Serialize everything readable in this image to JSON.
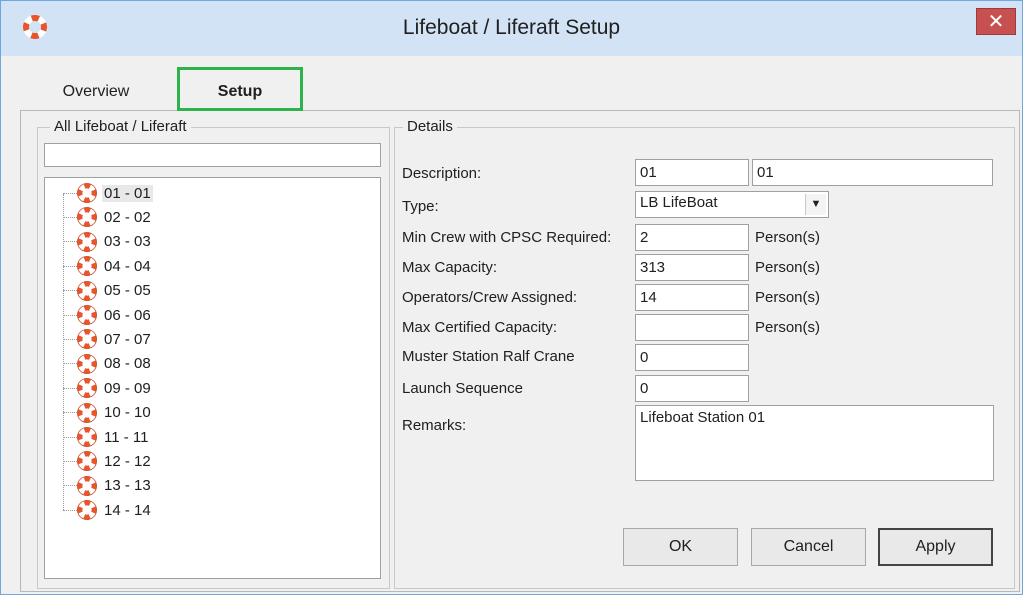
{
  "window": {
    "title": "Lifeboat / Liferaft Setup",
    "close_label": "✕"
  },
  "tabs": [
    {
      "label": "Overview"
    },
    {
      "label": "Setup"
    }
  ],
  "left_panel": {
    "legend": "All Lifeboat / Liferaft",
    "filter_value": "",
    "items": [
      {
        "label": "01 - 01"
      },
      {
        "label": "02 - 02"
      },
      {
        "label": "03 - 03"
      },
      {
        "label": "04 - 04"
      },
      {
        "label": "05 - 05"
      },
      {
        "label": "06 - 06"
      },
      {
        "label": "07 - 07"
      },
      {
        "label": "08 - 08"
      },
      {
        "label": "09 - 09"
      },
      {
        "label": "10 - 10"
      },
      {
        "label": "11 - 11"
      },
      {
        "label": "12 - 12"
      },
      {
        "label": "13 - 13"
      },
      {
        "label": "14 - 14"
      }
    ]
  },
  "details": {
    "legend": "Details",
    "description_label": "Description:",
    "description_code": "01",
    "description_name": "01",
    "type_label": "Type:",
    "type_value": "LB LifeBoat",
    "min_crew_label": "Min Crew with CPSC Required:",
    "min_crew_value": "2",
    "max_capacity_label": "Max Capacity:",
    "max_capacity_value": "313",
    "operators_label": "Operators/Crew Assigned:",
    "operators_value": "14",
    "max_certified_label": "Max Certified Capacity:",
    "max_certified_value": "",
    "muster_label": "Muster Station Ralf Crane",
    "muster_value": "0",
    "launch_label": "Launch Sequence",
    "launch_value": "0",
    "remarks_label": "Remarks:",
    "remarks_value": "Lifeboat Station 01",
    "unit_label": "Person(s)"
  },
  "buttons": {
    "ok": "OK",
    "cancel": "Cancel",
    "apply": "Apply"
  },
  "colors": {
    "titlebar": "#d2e3f5",
    "close": "#c75050",
    "tab_highlight": "#2db34a",
    "buoy": "#e8552b"
  },
  "icons": {
    "app": "lifebuoy-icon",
    "item": "lifebuoy-icon",
    "dropdown": "chevron-down-icon"
  }
}
